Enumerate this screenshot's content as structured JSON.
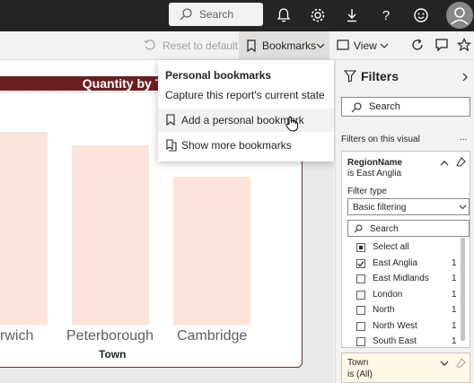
{
  "topbar": {
    "search_placeholder": "Search",
    "icons": [
      "search-icon",
      "bell-icon",
      "gear-icon",
      "download-icon",
      "help-icon",
      "smiley-icon",
      "user-avatar-icon"
    ]
  },
  "actionbar": {
    "reset_label": "Reset to default",
    "bookmarks_label": "Bookmarks",
    "view_label": "View"
  },
  "chart": {
    "title": "Quantity by Town",
    "xlabel": "Town",
    "categories": [
      "rwich",
      "Peterborough",
      "Cambridge"
    ]
  },
  "chart_data": {
    "type": "bar",
    "title": "Quantity by Town",
    "xlabel": "Town",
    "ylabel": "",
    "categories": [
      "rwich",
      "Peterborough",
      "Cambridge"
    ],
    "values": [
      0.86,
      0.8,
      0.66
    ],
    "bar_color": "#fde4da"
  },
  "bookmark_menu": {
    "header": "Personal bookmarks",
    "subheader": "Capture this report's current state",
    "items": [
      "Add a personal bookmark",
      "Show more bookmarks"
    ]
  },
  "filters": {
    "title": "Filters",
    "search_placeholder": "Search",
    "section_label": "Filters on this visual",
    "more": "...",
    "card1": {
      "field": "RegionName",
      "condition": "is East Anglia",
      "filter_type_label": "Filter type",
      "filter_type_value": "Basic filtering",
      "search_placeholder": "Search",
      "items": [
        {
          "name": "Select all",
          "count": "",
          "state": "partial"
        },
        {
          "name": "East Anglia",
          "count": "1",
          "state": "checked"
        },
        {
          "name": "East Midlands",
          "count": "1",
          "state": "unchecked"
        },
        {
          "name": "London",
          "count": "1",
          "state": "unchecked"
        },
        {
          "name": "North",
          "count": "1",
          "state": "unchecked"
        },
        {
          "name": "North West",
          "count": "1",
          "state": "unchecked"
        },
        {
          "name": "South East",
          "count": "1",
          "state": "unchecked"
        }
      ]
    },
    "card2": {
      "field": "Town",
      "condition": "is (All)"
    }
  }
}
